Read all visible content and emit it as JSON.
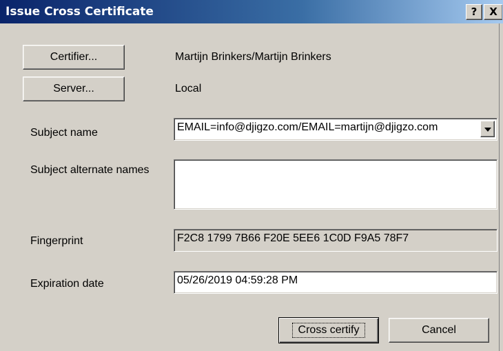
{
  "window": {
    "title": "Issue Cross Certificate",
    "help_label": "?",
    "close_label": "X"
  },
  "certifier": {
    "button_label": "Certifier...",
    "value": "Martijn Brinkers/Martijn Brinkers"
  },
  "server": {
    "button_label": "Server...",
    "value": "Local"
  },
  "subject_name": {
    "label": "Subject name",
    "value": "EMAIL=info@djigzo.com/EMAIL=martijn@djigzo.com"
  },
  "subject_alt_names": {
    "label": "Subject alternate names",
    "value": ""
  },
  "fingerprint": {
    "label": "Fingerprint",
    "value": "F2C8 1799 7B66 F20E 5EE6 1C0D F9A5 78F7"
  },
  "expiration": {
    "label": "Expiration date",
    "value": "05/26/2019 04:59:28 PM"
  },
  "buttons": {
    "cross_certify": "Cross certify",
    "cancel": "Cancel"
  }
}
